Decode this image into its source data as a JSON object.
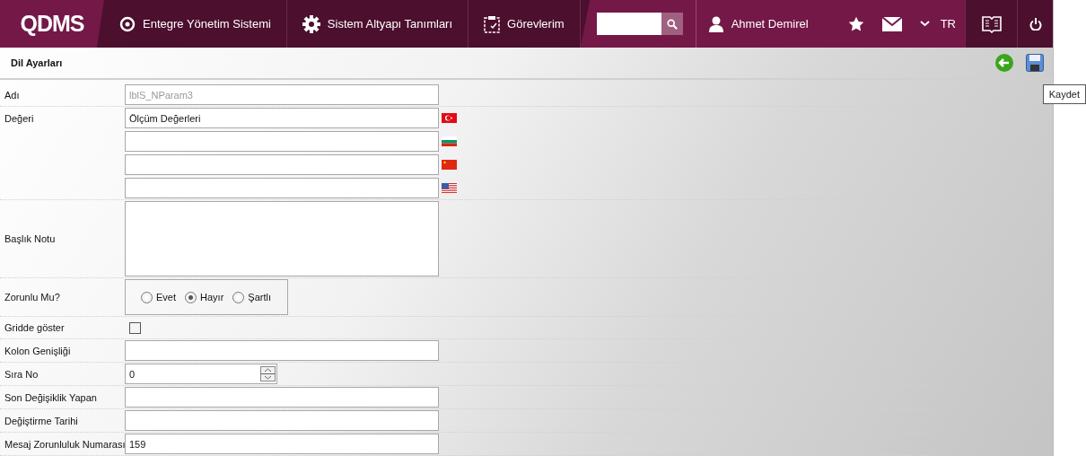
{
  "header": {
    "logo": "QDMS",
    "nav": [
      {
        "kind": "q",
        "label": "Entegre Yönetim Sistemi"
      },
      {
        "kind": "gear",
        "label": "Sistem Altyapı Tanımları"
      },
      {
        "kind": "clipboard",
        "label": "Görevlerim"
      }
    ],
    "user": "Ahmet Demirel",
    "language": "TR"
  },
  "page": {
    "title": "Dil Ayarları",
    "tooltip": "Kaydet"
  },
  "fields": [
    {
      "kind": "text",
      "label": "Adı",
      "value": "lblS_NParam3",
      "disabled": true
    },
    {
      "kind": "translations",
      "label": "Değeri",
      "items": [
        {
          "kind": "tr",
          "value": "Ölçüm Değerleri"
        },
        {
          "kind": "bg"
        },
        {
          "kind": "cn"
        },
        {
          "kind": "us"
        }
      ]
    },
    {
      "kind": "textarea",
      "label": "Başlık Notu"
    },
    {
      "kind": "radio",
      "label": "Zorunlu Mu?",
      "options": [
        {
          "label": "Evet",
          "selected": false
        },
        {
          "label": "Hayır",
          "selected": true
        },
        {
          "label": "Şartlı",
          "selected": false
        }
      ]
    },
    {
      "kind": "checkbox",
      "label": "Gridde göster",
      "checked": false
    },
    {
      "kind": "text",
      "label": "Kolon Genişliği"
    },
    {
      "kind": "number",
      "label": "Sıra No",
      "value": "0"
    },
    {
      "kind": "text",
      "label": "Son Değişiklik Yapan"
    },
    {
      "kind": "text",
      "label": "Değiştirme Tarihi"
    },
    {
      "kind": "text",
      "label": "Mesaj Zorunluluk Numarası",
      "value": "159",
      "disabled": false
    }
  ]
}
